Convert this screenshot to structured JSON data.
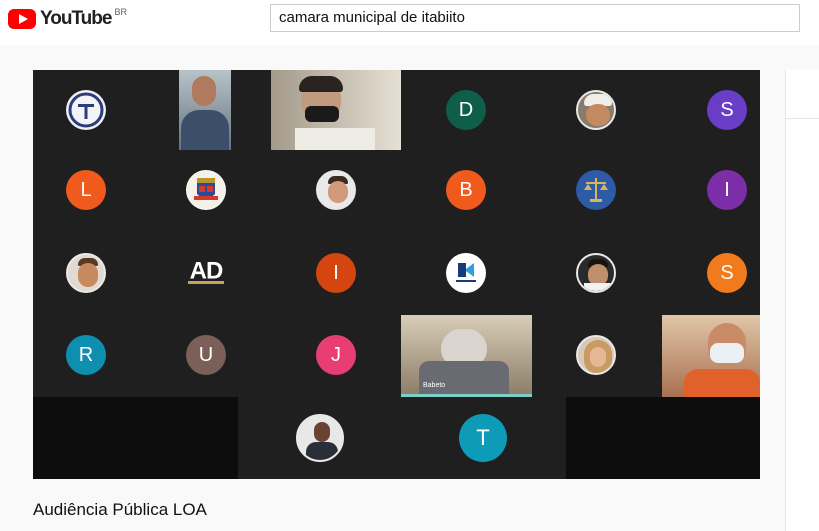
{
  "header": {
    "logo_text": "YouTube",
    "country_code": "BR",
    "search_value": "camara municipal de itabiito"
  },
  "video": {
    "title": "Audiência Pública LOA",
    "participants": {
      "d": {
        "letter": "D",
        "color": "#0f5e4a"
      },
      "s1": {
        "letter": "S",
        "color": "#6a3dc6"
      },
      "l": {
        "letter": "L",
        "color": "#f05a1c"
      },
      "b": {
        "letter": "B",
        "color": "#f05a1c"
      },
      "i1": {
        "letter": "I",
        "color": "#7b2ea8"
      },
      "ad": {
        "text": "AD"
      },
      "i2": {
        "letter": "I",
        "color": "#d4450f"
      },
      "s2": {
        "letter": "S",
        "color": "#f07a1c"
      },
      "r": {
        "letter": "R",
        "color": "#0e8fb0"
      },
      "u": {
        "letter": "U",
        "color": "#7a6058"
      },
      "j": {
        "letter": "J",
        "color": "#e83e74"
      },
      "t": {
        "letter": "T",
        "color": "#0e9bb8"
      },
      "name_tag": "Babeto"
    }
  }
}
